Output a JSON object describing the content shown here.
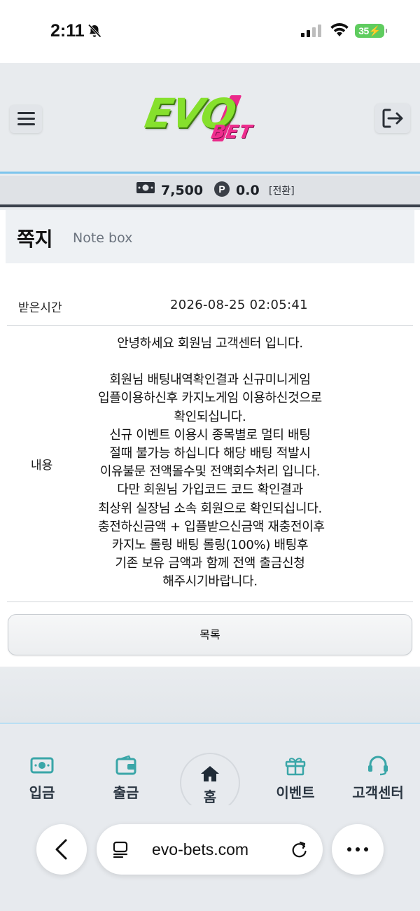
{
  "status_bar": {
    "time": "2:11",
    "battery": "35"
  },
  "header": {
    "logo_main": "EVO",
    "logo_sub": "BET"
  },
  "balance": {
    "money": "7,500",
    "point_symbol": "P",
    "point": "0.0",
    "convert_label": "[전환]"
  },
  "page": {
    "title": "쪽지",
    "subtitle": "Note box"
  },
  "note": {
    "received_label": "받은시간",
    "received_time": "2026-08-25 02:05:41",
    "content_label": "내용",
    "greeting": "안녕하세요 회원님 고객센터 입니다.",
    "body_lines": [
      "회원님 배팅내역확인결과 신규미니게임",
      "입플이용하신후 카지노게임 이용하신것으로",
      "확인되십니다.",
      "신규 이벤트 이용시 종목별로 멀티 배팅",
      "절때 불가능 하십니다 해당 배팅 적발시",
      "이유불문 전액몰수및 전액회수처리 입니다.",
      "다만 회원님 가입코드 코드 확인결과",
      "최상위 실장님 소속 회원으로 확인되십니다.",
      "충전하신금액 + 입플받으신금액 재충전이후",
      "카지노 롤링 배팅 롤링(100%) 배팅후",
      "기존 보유 금액과 함께 전액 출금신청",
      "해주시기바랍니다."
    ],
    "list_button": "목록"
  },
  "bottom_nav": {
    "items": [
      {
        "label": "입금",
        "icon": "deposit-icon"
      },
      {
        "label": "출금",
        "icon": "withdraw-icon"
      },
      {
        "label": "홈",
        "icon": "home-icon"
      },
      {
        "label": "이벤트",
        "icon": "gift-icon"
      },
      {
        "label": "고객센터",
        "icon": "headset-icon"
      }
    ]
  },
  "browser": {
    "url": "evo-bets.com"
  },
  "colors": {
    "accent_line": "#7cc4ec",
    "nav_icon": "#3aa6a8",
    "logo_green": "#86e02d",
    "logo_pink": "#ef2d8e",
    "battery": "#5fcc5f"
  }
}
